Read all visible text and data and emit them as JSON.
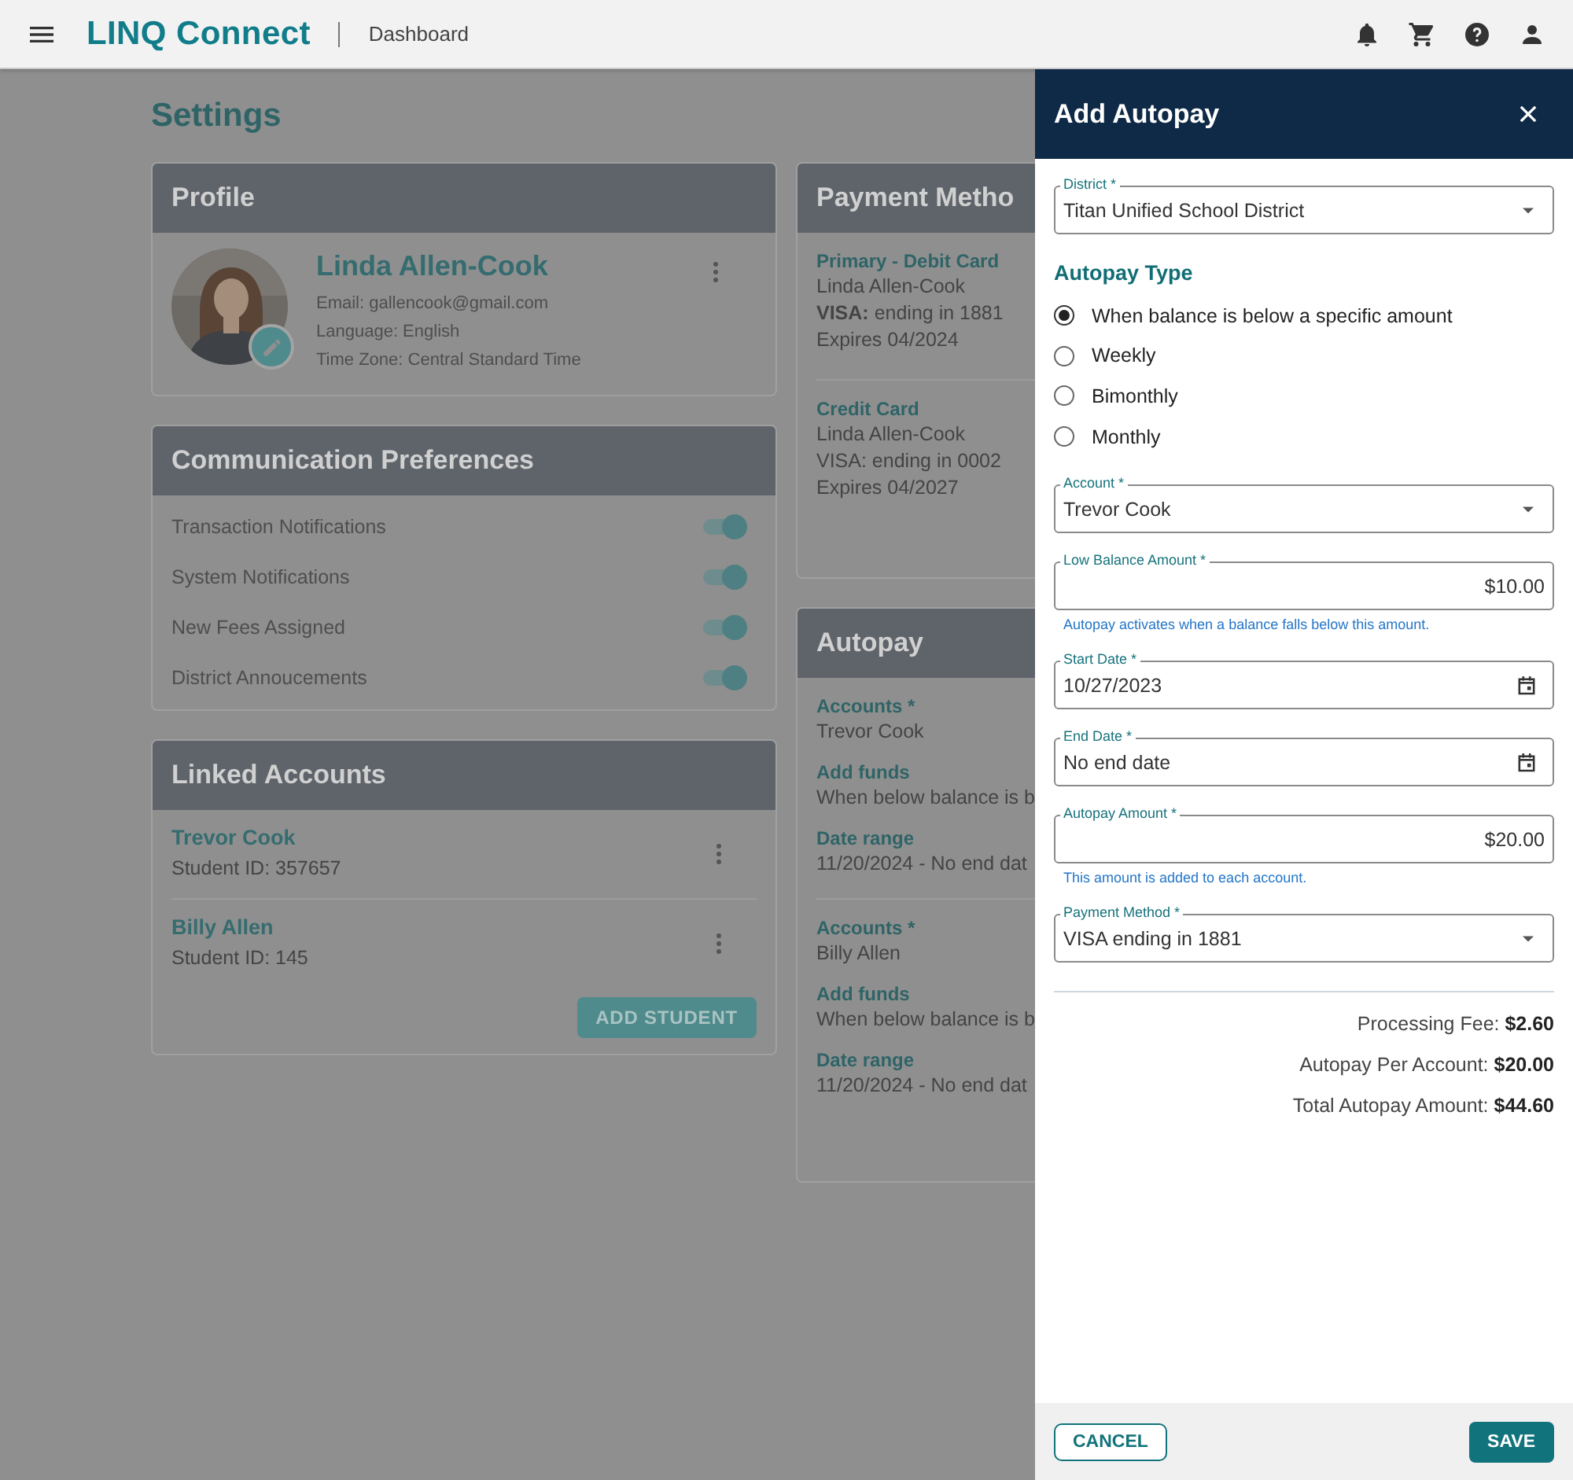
{
  "topbar": {
    "logo": "LINQ Connect",
    "page": "Dashboard"
  },
  "page_title": "Settings",
  "profile": {
    "title": "Profile",
    "name": "Linda Allen-Cook",
    "lines": [
      "Email: gallencook@gmail.com",
      "Language: English",
      "Time Zone: Central Standard Time"
    ]
  },
  "communication": {
    "title": "Communication Preferences",
    "items": [
      {
        "label": "Transaction Notifications",
        "on": true
      },
      {
        "label": "System Notifications",
        "on": true
      },
      {
        "label": "New Fees Assigned",
        "on": true
      },
      {
        "label": "District Annoucements",
        "on": true
      }
    ]
  },
  "linked_accounts": {
    "title": "Linked Accounts",
    "items": [
      {
        "name": "Trevor Cook",
        "detail": "Student ID: 357657"
      },
      {
        "name": "Billy Allen",
        "detail": "Student ID: 145"
      }
    ],
    "button": "ADD STUDENT"
  },
  "payment_methods": {
    "title": "Payment Metho",
    "items": [
      {
        "heading": "Primary - Debit Card",
        "lines": [
          "Linda Allen-Cook",
          "**VISA:** ending in 1881",
          "Expires 04/2024"
        ]
      },
      {
        "heading": "Credit Card",
        "lines": [
          "Linda Allen-Cook",
          "VISA: ending in 0002",
          "Expires 04/2027"
        ]
      }
    ]
  },
  "autopay": {
    "title": "Autopay",
    "groups": [
      [
        {
          "label": "Accounts *",
          "value": "Trevor Cook"
        },
        {
          "label": "Add funds",
          "value": "When below balance is b"
        },
        {
          "label": "Date range",
          "value": "11/20/2024 - No end dat"
        }
      ],
      [
        {
          "label": "Accounts *",
          "value": "Billy Allen"
        },
        {
          "label": "Add funds",
          "value": "When below balance is b"
        },
        {
          "label": "Date range",
          "value": "11/20/2024 - No end dat"
        }
      ]
    ]
  },
  "drawer": {
    "title": "Add Autopay",
    "district": {
      "kind": "select",
      "label": "District *",
      "value": "Titan Unified School District"
    },
    "type_heading": "Autopay Type",
    "types": [
      {
        "label": "When balance is below a specific amount",
        "selected": true
      },
      {
        "label": "Weekly",
        "selected": false
      },
      {
        "label": "Bimonthly",
        "selected": false
      },
      {
        "label": "Monthly",
        "selected": false
      }
    ],
    "fields": [
      {
        "kind": "select",
        "label": "Account *",
        "value": "Trevor Cook"
      },
      {
        "kind": "amount",
        "label": "Low Balance Amount *",
        "value": "$10.00",
        "helper": "Autopay activates when a balance falls below this amount."
      },
      {
        "kind": "date",
        "label": "Start Date *",
        "value": "10/27/2023"
      },
      {
        "kind": "date",
        "label": "End Date *",
        "value": "No end date"
      },
      {
        "kind": "amount",
        "label": "Autopay Amount *",
        "value": "$20.00",
        "helper": "This amount is added to each account."
      },
      {
        "kind": "select",
        "label": "Payment Method *",
        "value": "VISA ending in 1881"
      }
    ],
    "totals": [
      "Processing Fee: **$2.60**",
      "Autopay Per Account: **$20.00**",
      "Total Autopay Amount: **$44.60**"
    ],
    "cancel": "CANCEL",
    "save": "SAVE"
  }
}
